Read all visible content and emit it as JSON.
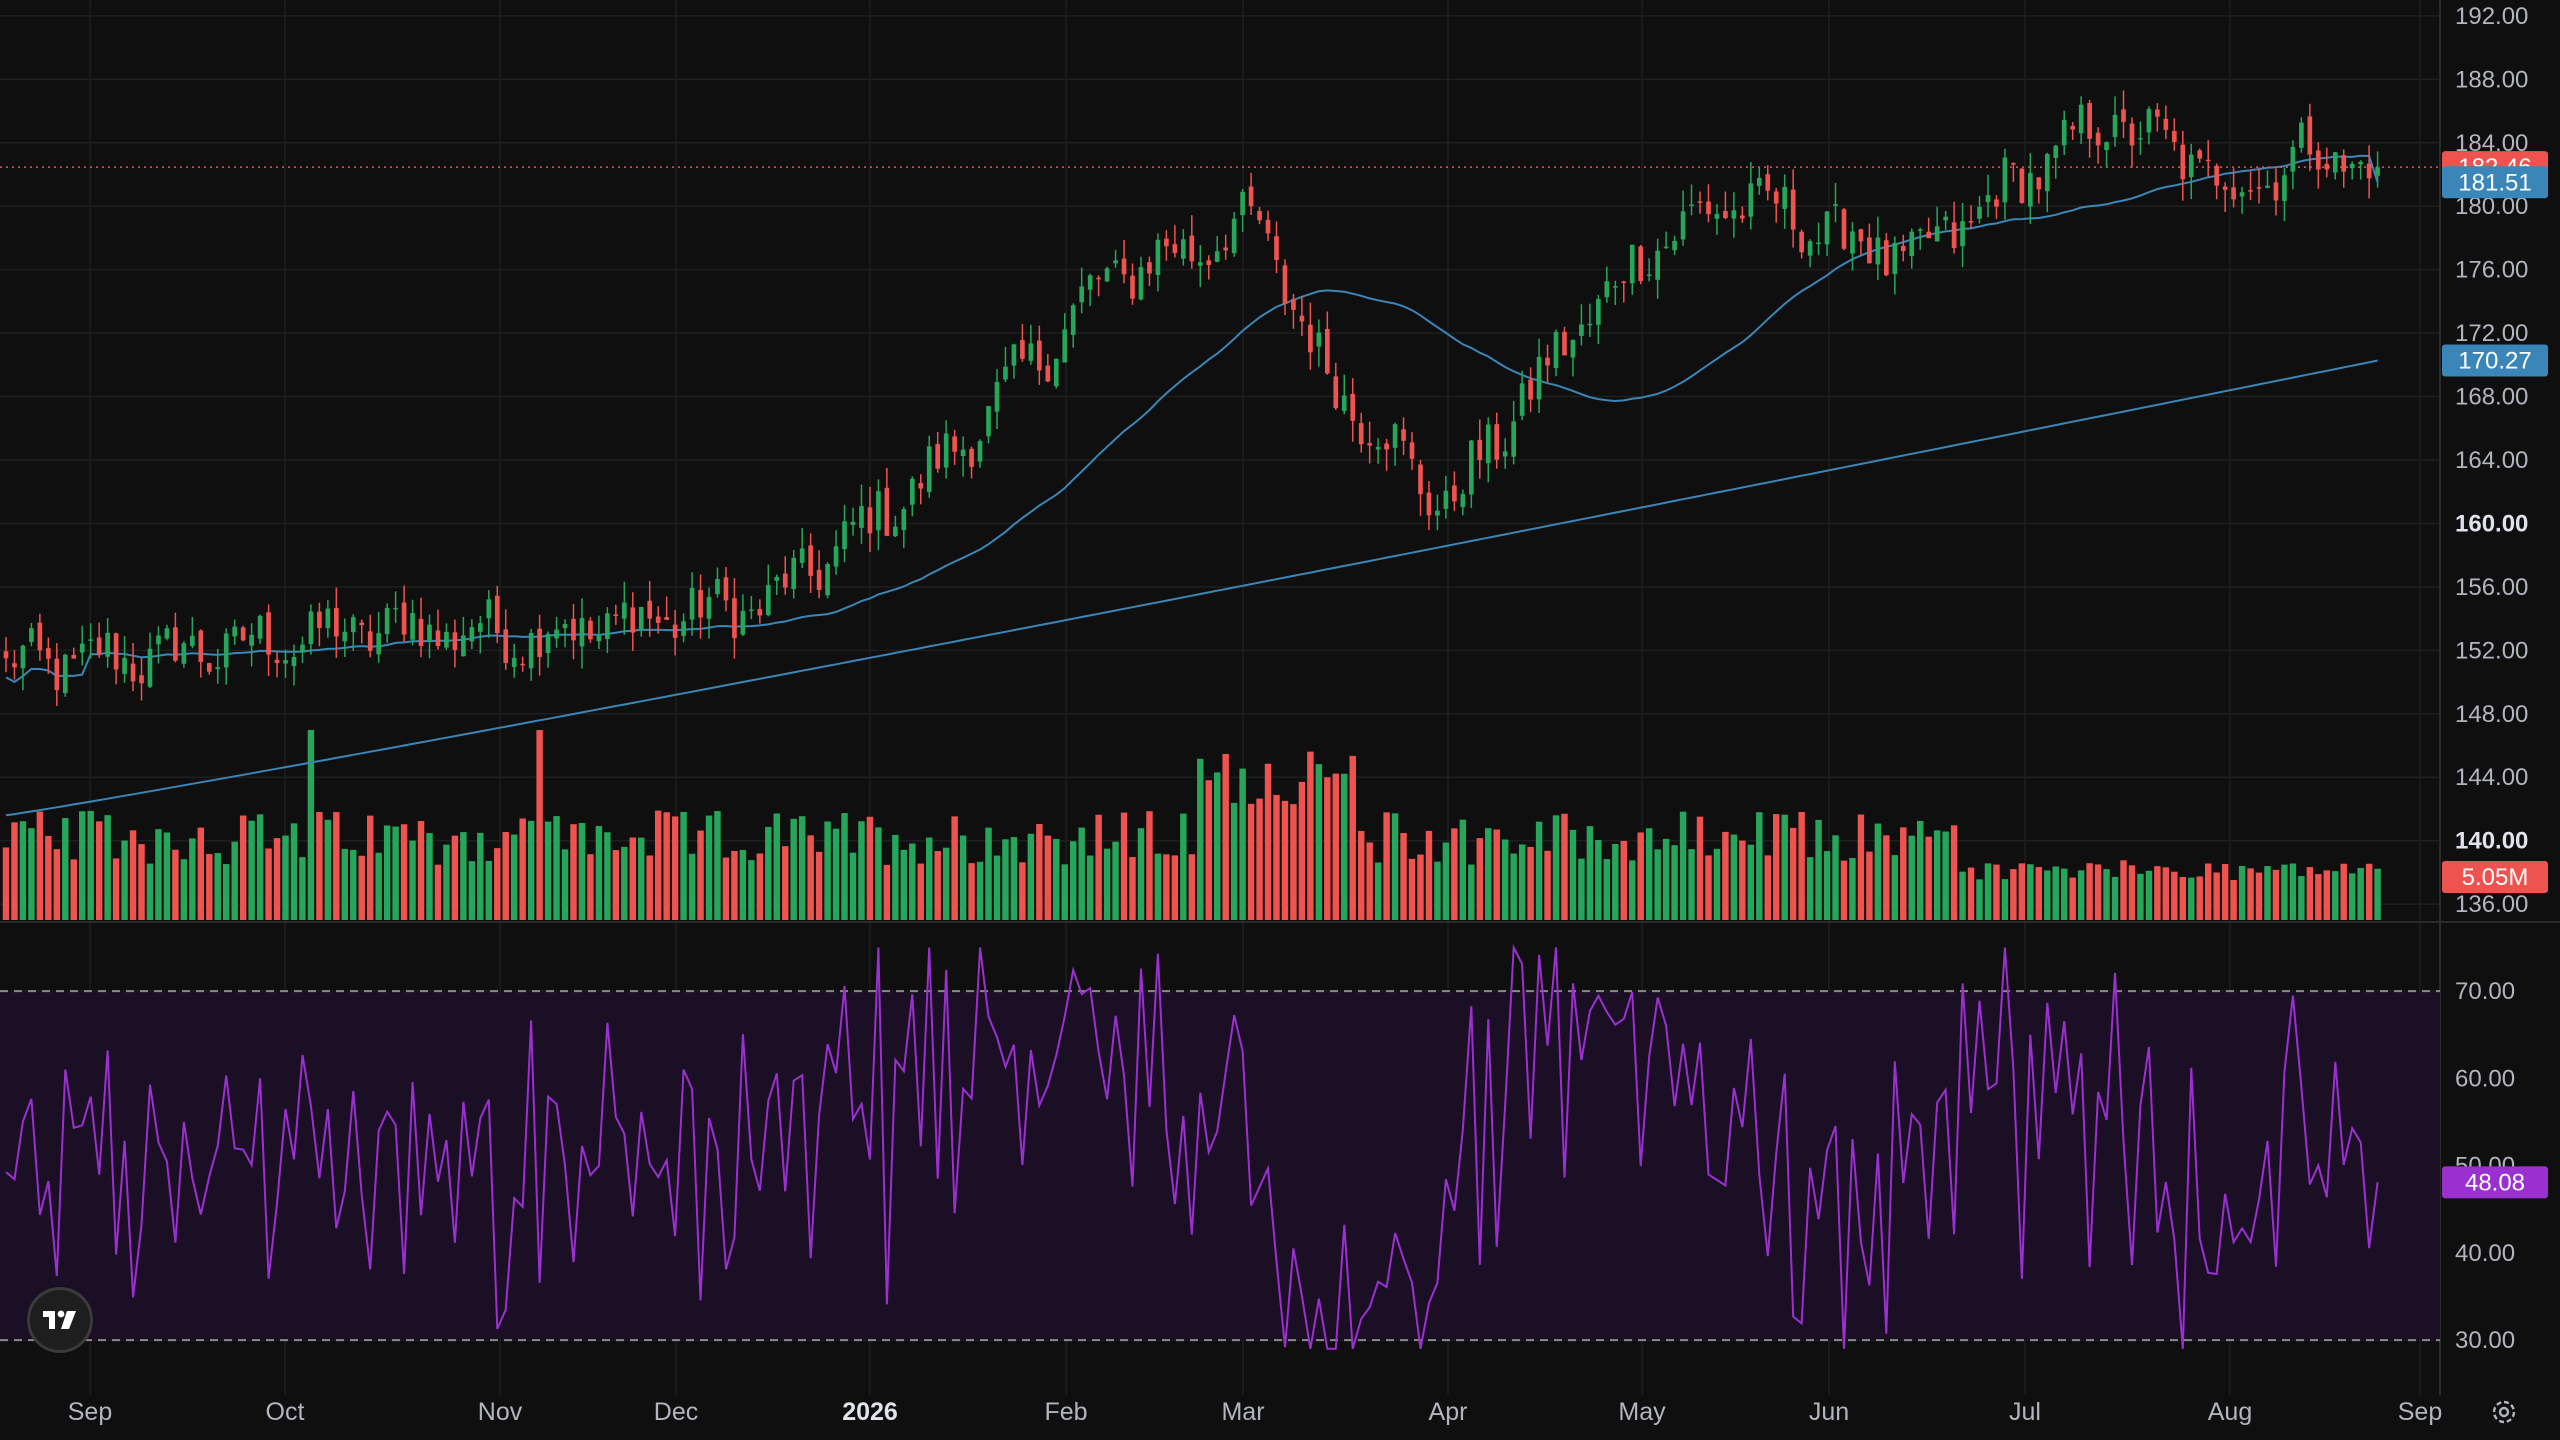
{
  "colors": {
    "background": "#0f0f0f",
    "up": "#26a65b",
    "down": "#ef5350",
    "ma": "#3a86b8",
    "rsi": "#9b30d0",
    "rsi_band": "#1a0f24",
    "grid": "#1f1f1f",
    "price_line": "#ef5350"
  },
  "icons": {
    "logo": "tradingview-logo-icon",
    "settings": "gear-icon"
  },
  "chart_data": [
    {
      "type": "candlestick",
      "price_axis": {
        "ticks": [
          "192.00",
          "188.00",
          "184.00",
          "180.00",
          "176.00",
          "172.00",
          "168.00",
          "164.00",
          "160.00",
          "156.00",
          "152.00",
          "148.00",
          "144.00",
          "140.00",
          "136.00"
        ],
        "bold_ticks": [
          "160.00",
          "140.00"
        ],
        "range": [
          135,
          193
        ]
      },
      "time_axis": {
        "labels": [
          "Sep",
          "Oct",
          "Nov",
          "Dec",
          "2026",
          "Feb",
          "Mar",
          "Apr",
          "May",
          "Jun",
          "Jul",
          "Aug",
          "Sep"
        ],
        "bold_labels": [
          "2026"
        ]
      },
      "anchors": {
        "x_days": [
          0,
          22,
          43,
          60,
          85,
          107,
          122,
          143,
          163,
          183,
          203,
          223,
          239
        ],
        "close": [
          151.0,
          151.8,
          153.5,
          153.0,
          155.0,
          163.5,
          175.5,
          179.0,
          170.0,
          161.0,
          172.0,
          178.0,
          180.5,
          176.5,
          181.8,
          185.5,
          183.0,
          181.0,
          183.5,
          182.46
        ],
        "close_days": [
          0,
          20,
          45,
          62,
          90,
          110,
          130,
          148,
          155,
          170,
          185,
          195,
          205,
          225,
          238,
          248,
          258,
          263,
          272,
          280
        ],
        "close_days_note": ""
      },
      "series": [
        {
          "name": "",
          "kind": "ma",
          "last_value": "181.51"
        },
        {
          "name": "",
          "kind": "ma",
          "last_value": "170.27"
        }
      ],
      "last_price": "182.46",
      "grid": true
    },
    {
      "type": "bar",
      "series": [
        {
          "name": "",
          "last_value": "5.05M"
        }
      ],
      "grid": false
    },
    {
      "type": "line",
      "series": [
        {
          "name": "",
          "last_value": "48.08"
        }
      ],
      "rsi_axis": {
        "ticks": [
          "70.00",
          "60.00",
          "50.00",
          "40.00",
          "30.00"
        ],
        "range": [
          26,
          77
        ]
      },
      "bands": [
        30,
        70
      ],
      "grid": true
    }
  ]
}
